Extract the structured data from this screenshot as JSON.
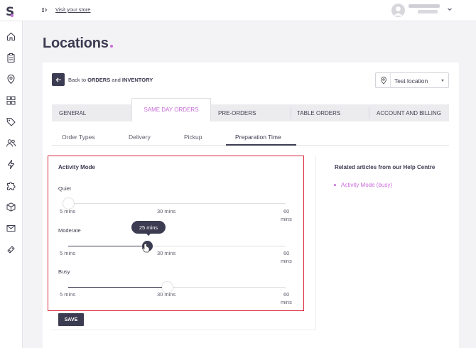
{
  "header": {
    "visit_store": "Visit your store"
  },
  "page": {
    "title": "Locations"
  },
  "back": {
    "prefix": "Back to ",
    "orders": "ORDERS",
    "and": " and ",
    "inventory": "INVENTORY"
  },
  "location_select": {
    "value": "Test location"
  },
  "main_tabs": [
    {
      "label": "GENERAL",
      "active": false
    },
    {
      "label": "SAME DAY ORDERS",
      "active": true
    },
    {
      "label": "PRE-ORDERS",
      "active": false
    },
    {
      "label": "TABLE ORDERS",
      "active": false
    },
    {
      "label": "ACCOUNT AND BILLING",
      "active": false
    }
  ],
  "sub_tabs": [
    {
      "label": "Order Types",
      "active": false
    },
    {
      "label": "Delivery",
      "active": false
    },
    {
      "label": "Pickup",
      "active": false
    },
    {
      "label": "Preparation Time",
      "active": true
    }
  ],
  "activity_mode": {
    "title": "Activity Mode",
    "ticks": {
      "min": "5 mins",
      "mid": "30 mins",
      "max": "60",
      "max_unit": "mins"
    },
    "sliders": [
      {
        "label": "Quiet",
        "value_mins": 5
      },
      {
        "label": "Moderate",
        "value_mins": 25,
        "tooltip": "25 mins"
      },
      {
        "label": "Busy",
        "value_mins": 30
      }
    ],
    "range_mins": [
      5,
      60
    ]
  },
  "save_label": "SAVE",
  "help": {
    "title": "Related articles from our Help Centre",
    "links": [
      "Activity Mode (busy)"
    ]
  },
  "colors": {
    "accent": "#c86dd7",
    "primary": "#3b3b52",
    "highlight_border": "#d9273a"
  }
}
